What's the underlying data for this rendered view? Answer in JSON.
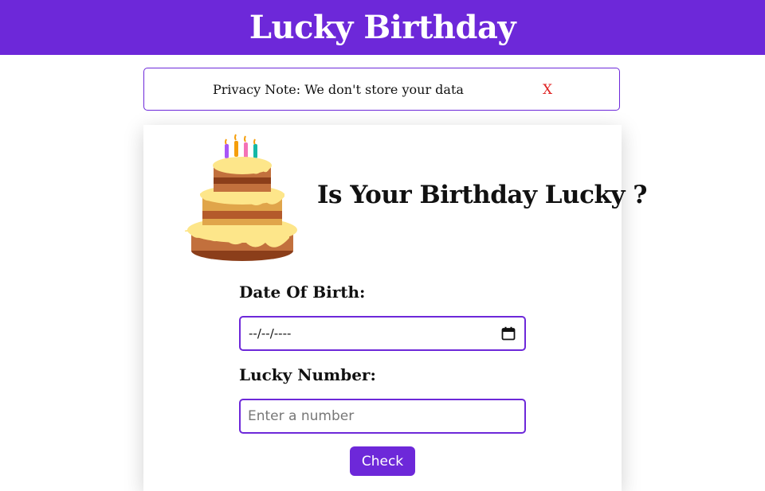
{
  "header": {
    "title": "Lucky Birthday"
  },
  "privacy": {
    "note": "Privacy Note: We don't store your data",
    "close_label": "X"
  },
  "card": {
    "title": "Is Your Birthday Lucky ?",
    "cake_icon": "birthday-cake-icon",
    "dob": {
      "label": "Date Of Birth:",
      "value": "--/--/----",
      "icon": "calendar-icon"
    },
    "lucky": {
      "label": "Lucky Number:",
      "placeholder": "Enter a number"
    },
    "check_label": "Check"
  },
  "colors": {
    "accent": "#6d28d9",
    "close": "#e02424",
    "text": "#111111"
  }
}
